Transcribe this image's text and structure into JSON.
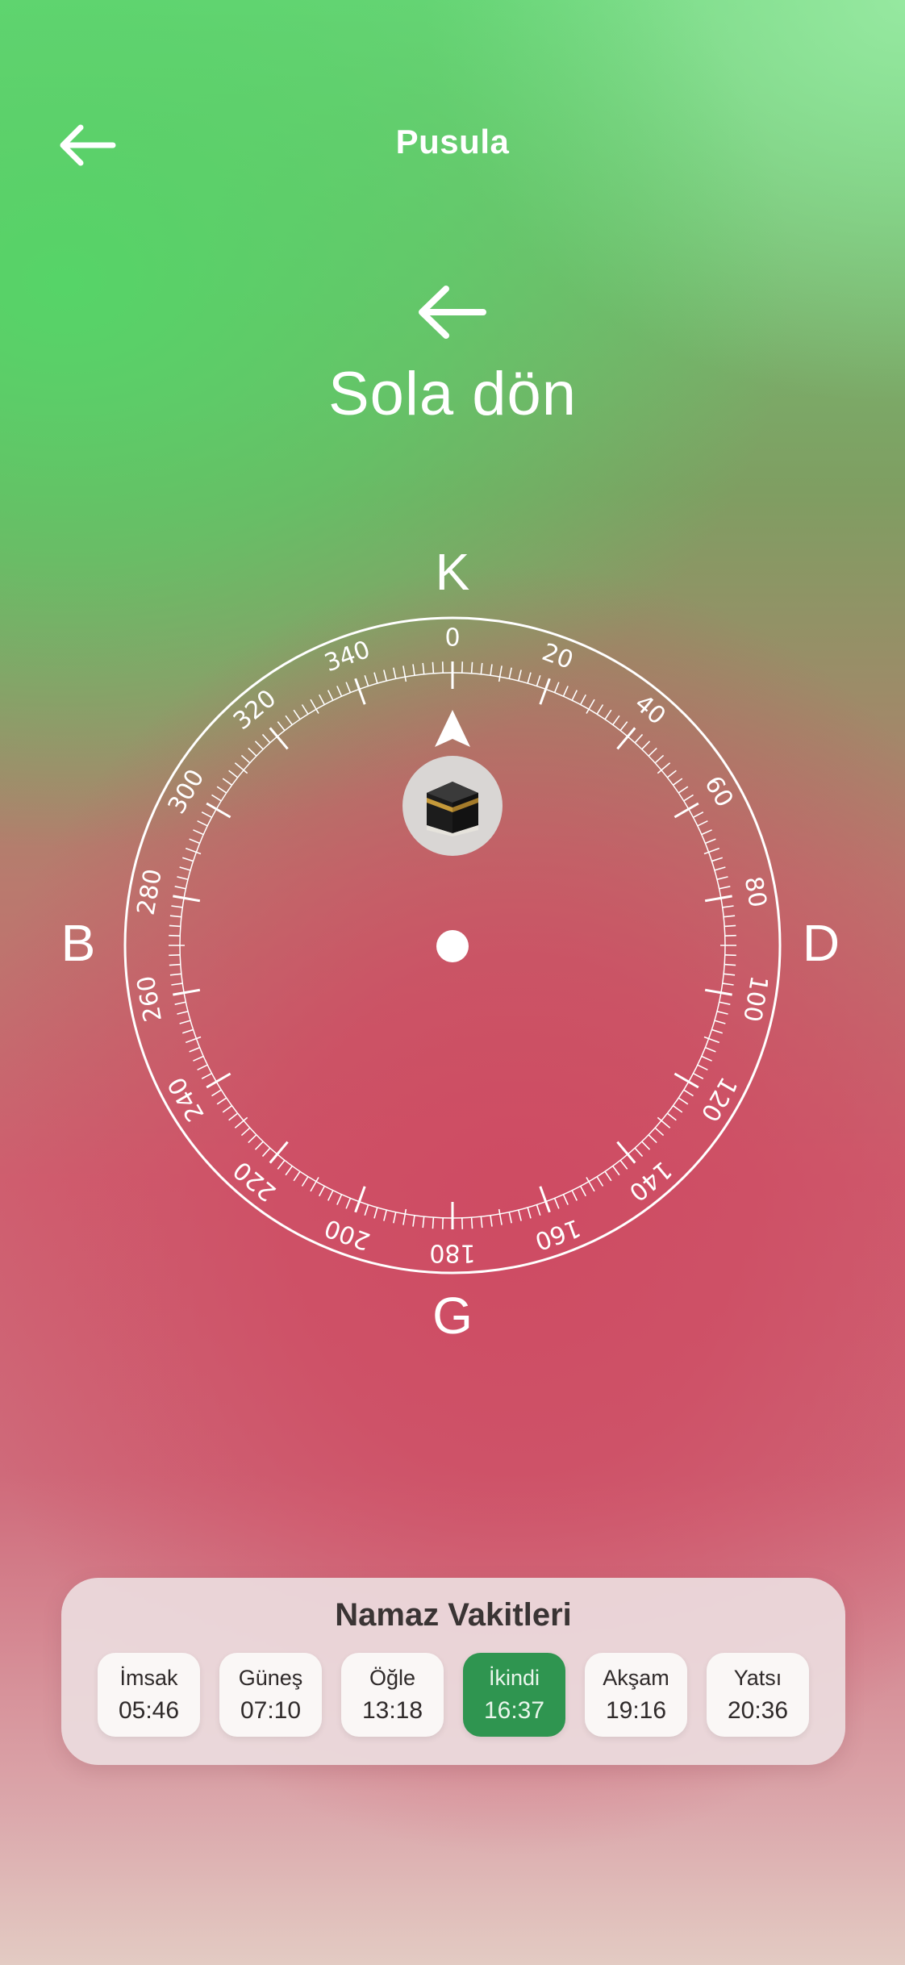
{
  "header": {
    "title": "Pusula"
  },
  "instruction": {
    "text": "Sola dön"
  },
  "compass": {
    "north": "K",
    "south": "G",
    "west": "B",
    "east": "D",
    "ticks": [
      "0",
      "20",
      "40",
      "60",
      "80",
      "100",
      "120",
      "140",
      "160",
      "180",
      "200",
      "220",
      "240",
      "260",
      "280",
      "300",
      "320",
      "340"
    ]
  },
  "prayer_times": {
    "title": "Namaz Vakitleri",
    "items": [
      {
        "name": "İmsak",
        "time": "05:46"
      },
      {
        "name": "Güneş",
        "time": "07:10"
      },
      {
        "name": "Öğle",
        "time": "13:18"
      },
      {
        "name": "İkindi",
        "time": "16:37",
        "active": true
      },
      {
        "name": "Akşam",
        "time": "19:16"
      },
      {
        "name": "Yatsı",
        "time": "20:36"
      }
    ]
  },
  "colors": {
    "active": "#2f9550",
    "text_dark": "#3a3434"
  },
  "icons": {
    "back": "arrow-left-icon",
    "turn": "arrow-left-icon",
    "qibla": "kaaba-icon",
    "pointer": "navigation-arrow-icon"
  }
}
